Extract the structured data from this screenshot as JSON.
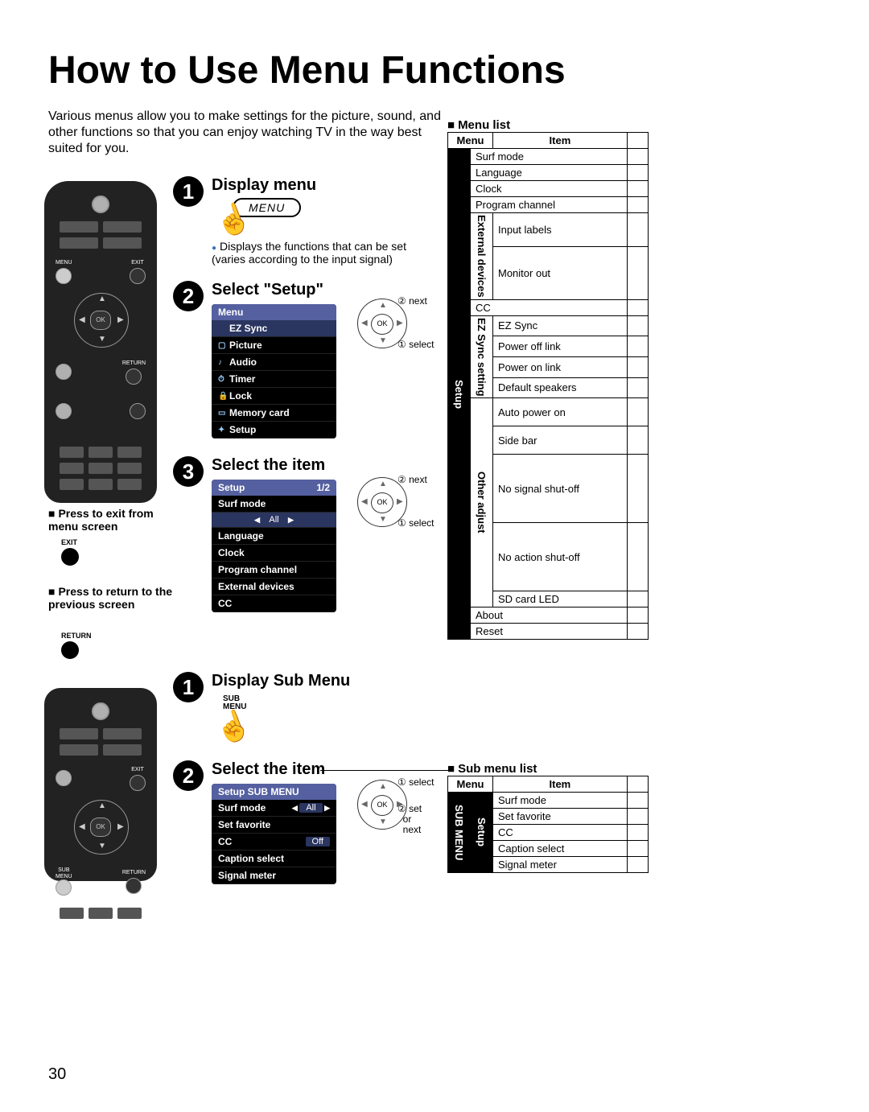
{
  "title": "How to Use Menu Functions",
  "intro": "Various menus allow you to make settings for the picture, sound, and other functions so that you can enjoy watching TV in the way best suited for you.",
  "page_number": "30",
  "remote_labels": {
    "menu": "MENU",
    "exit": "EXIT",
    "ok": "OK",
    "return": "RETURN",
    "sub1": "SUB",
    "sub2": "MENU"
  },
  "steps_main": [
    {
      "num": "1",
      "title": "Display menu",
      "btn": "MENU",
      "note": "Displays the functions that can be set (varies according to the input signal)"
    },
    {
      "num": "2",
      "title": "Select \"Setup\""
    },
    {
      "num": "3",
      "title": "Select the item"
    }
  ],
  "steps_sub": [
    {
      "num": "1",
      "title": "Display Sub Menu",
      "lbl1": "SUB",
      "lbl2": "MENU"
    },
    {
      "num": "2",
      "title": "Select the item"
    }
  ],
  "left_instr": {
    "exit": "Press to exit from menu screen",
    "exit_btn": "EXIT",
    "return": "Press to return to the previous screen",
    "return_btn": "RETURN"
  },
  "osd_menu": {
    "title": "Menu",
    "items": [
      "EZ Sync",
      "Picture",
      "Audio",
      "Timer",
      "Lock",
      "Memory card",
      "Setup"
    ]
  },
  "osd_setup": {
    "title": "Setup",
    "page": "1/2",
    "surf": "Surf mode",
    "surf_val": "All",
    "items": [
      "Language",
      "Clock",
      "Program channel",
      "External devices",
      "CC"
    ]
  },
  "osd_submenu": {
    "title": "Setup SUB MENU",
    "surf": "Surf mode",
    "surf_val": "All",
    "items": [
      "Set favorite"
    ],
    "cc": "CC",
    "cc_val": "Off",
    "items2": [
      "Caption select",
      "Signal meter"
    ]
  },
  "callout_labels": {
    "next": "next",
    "select": "select",
    "set": "set",
    "or": "or",
    "c1": "①",
    "c2": "②"
  },
  "menu_list": {
    "heading": "Menu list",
    "col_menu": "Menu",
    "col_item": "Item",
    "setup": "Setup",
    "items_top": [
      "Surf mode",
      "Language",
      "Clock",
      "Program channel"
    ],
    "external": "External devices",
    "external_items": [
      "Input labels",
      "Monitor out"
    ],
    "cc": "CC",
    "ezsync": "EZ Sync setting",
    "ezsync_items": [
      "EZ Sync",
      "Power off link",
      "Power on link",
      "Default speakers"
    ],
    "other": "Other adjust",
    "other_items": [
      "Auto power on",
      "Side bar",
      "No signal shut-off",
      "No action shut-off",
      "SD card LED"
    ],
    "items_bottom": [
      "About",
      "Reset"
    ]
  },
  "sub_menu_list": {
    "heading": "Sub menu list",
    "col_menu": "Menu",
    "col_item": "Item",
    "menu_label_1": "Setup",
    "menu_label_2": "SUB MENU",
    "items": [
      "Surf mode",
      "Set favorite",
      "CC",
      "Caption select",
      "Signal meter"
    ]
  }
}
